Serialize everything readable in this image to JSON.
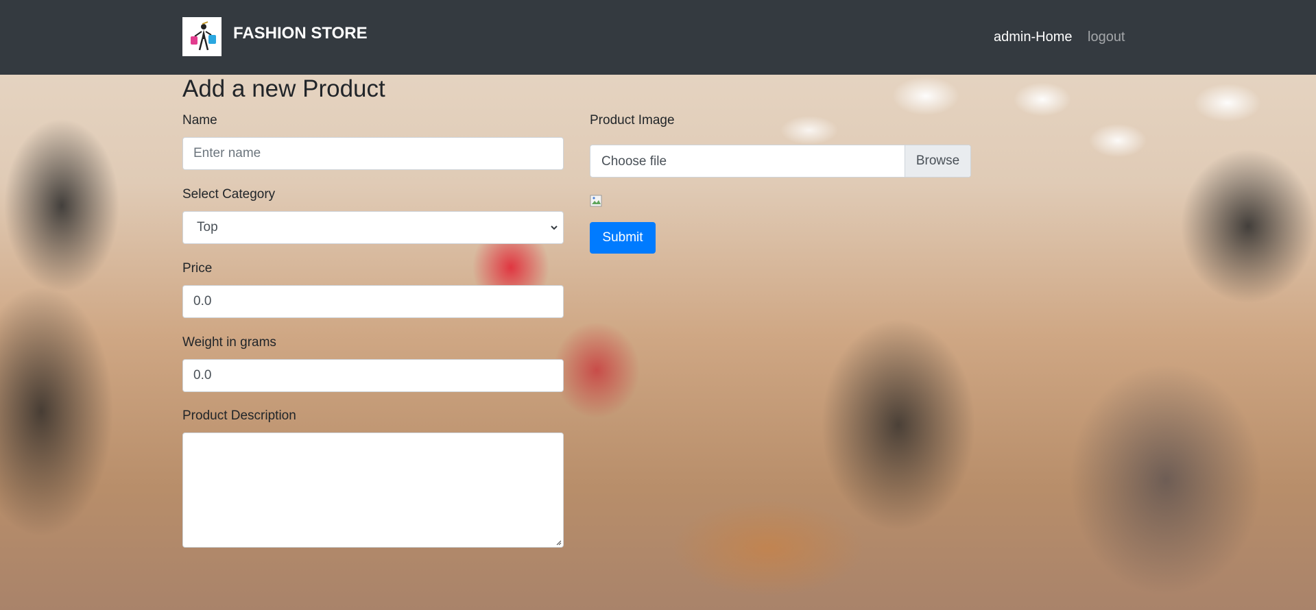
{
  "navbar": {
    "brand": "FASHION STORE",
    "links": [
      {
        "label": "admin-Home"
      },
      {
        "label": "logout"
      }
    ]
  },
  "form": {
    "title": "Add a new Product",
    "name": {
      "label": "Name",
      "placeholder": "Enter name",
      "value": ""
    },
    "category": {
      "label": "Select Category",
      "selected": "Top"
    },
    "price": {
      "label": "Price",
      "value": "0.0"
    },
    "weight": {
      "label": "Weight in grams",
      "value": "0.0"
    },
    "description": {
      "label": "Product Description",
      "value": ""
    },
    "image": {
      "label": "Product Image",
      "file_placeholder": "Choose file",
      "browse_label": "Browse"
    },
    "submit_label": "Submit"
  },
  "colors": {
    "navbar": "#343a40",
    "primary": "#007bff"
  }
}
